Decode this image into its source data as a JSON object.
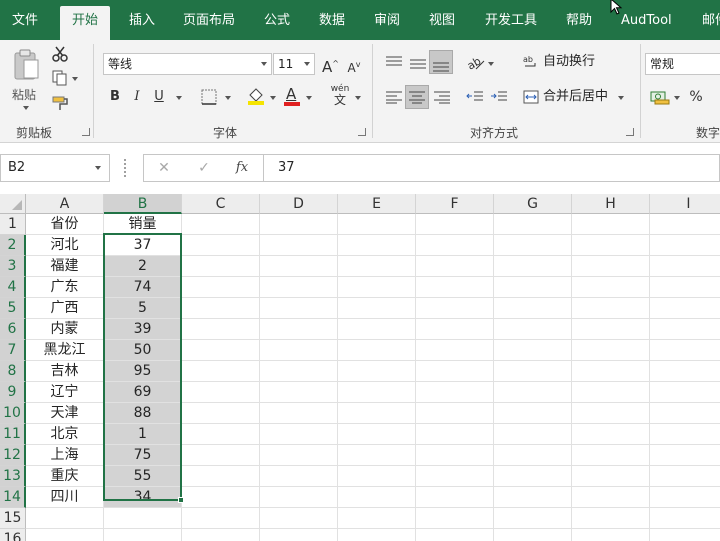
{
  "tabs": [
    "文件",
    "开始",
    "插入",
    "页面布局",
    "公式",
    "数据",
    "审阅",
    "视图",
    "开发工具",
    "帮助",
    "AudTool",
    "邮件"
  ],
  "active_tab": "开始",
  "ribbon": {
    "clipboard": {
      "paste_label": "粘贴",
      "group_label": "剪贴板"
    },
    "font": {
      "family": "等线",
      "size": "11",
      "bold": "B",
      "italic": "I",
      "underline": "U",
      "grow": "A",
      "shrink": "A",
      "color_letter": "A",
      "wen": "wén",
      "wen_char": "文",
      "group_label": "字体"
    },
    "alignment": {
      "wrap_text": "自动换行",
      "merge_center": "合并后居中",
      "group_label": "对齐方式"
    },
    "number": {
      "format": "常规",
      "percent": "%",
      "group_label": "数字"
    }
  },
  "formula_bar": {
    "name_box": "B2",
    "formula": "37",
    "cancel": "✕",
    "enter": "✓",
    "fx": "fx"
  },
  "columns": [
    "A",
    "B",
    "C",
    "D",
    "E",
    "F",
    "G",
    "H",
    "I"
  ],
  "rows": [
    "1",
    "2",
    "3",
    "4",
    "5",
    "6",
    "7",
    "8",
    "9",
    "10",
    "11",
    "12",
    "13",
    "14",
    "15",
    "16"
  ],
  "sheet": {
    "headers": [
      "省份",
      "销量"
    ],
    "data": [
      [
        "河北",
        "37"
      ],
      [
        "福建",
        "2"
      ],
      [
        "广东",
        "74"
      ],
      [
        "广西",
        "5"
      ],
      [
        "内蒙",
        "39"
      ],
      [
        "黑龙江",
        "50"
      ],
      [
        "吉林",
        "95"
      ],
      [
        "辽宁",
        "69"
      ],
      [
        "天津",
        "88"
      ],
      [
        "北京",
        "1"
      ],
      [
        "上海",
        "75"
      ],
      [
        "重庆",
        "55"
      ],
      [
        "四川",
        "34"
      ]
    ]
  },
  "colors": {
    "accent": "#217346",
    "selection_fill": "#d3d3d3",
    "font_color_bar": "#e02020",
    "fill_bar": "#f5e400"
  }
}
